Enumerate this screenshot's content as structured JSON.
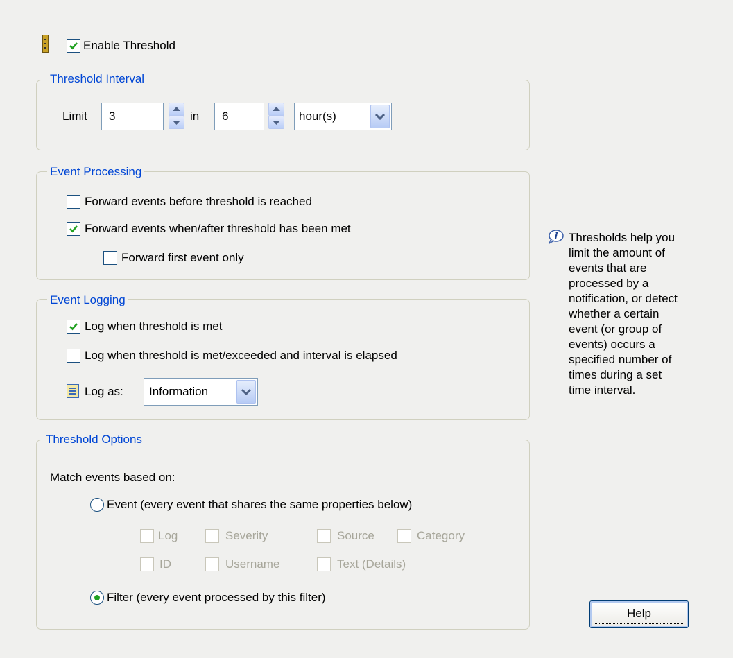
{
  "enable_threshold": {
    "label": "Enable Threshold",
    "checked": true,
    "icon": "ruler-icon"
  },
  "threshold_interval": {
    "legend": "Threshold Interval",
    "limit_label": "Limit",
    "limit_value": "3",
    "in_label": "in",
    "interval_value": "6",
    "unit_value": "hour(s)"
  },
  "event_processing": {
    "legend": "Event Processing",
    "forward_before": {
      "label": "Forward events before threshold is reached",
      "checked": false
    },
    "forward_after": {
      "label": "Forward events when/after threshold has been met",
      "checked": true
    },
    "forward_first": {
      "label": "Forward first event only",
      "checked": false
    }
  },
  "event_logging": {
    "legend": "Event Logging",
    "log_when_met": {
      "label": "Log when threshold is met",
      "checked": true
    },
    "log_when_exceeded": {
      "label": "Log when threshold is met/exceeded and interval is elapsed",
      "checked": false
    },
    "log_as_label": "Log as:",
    "log_as_value": "Information",
    "log_icon": "log-book-icon"
  },
  "threshold_options": {
    "legend": "Threshold Options",
    "match_label": "Match events based on:",
    "event_radio": {
      "label": "Event (every event that shares the same properties below)",
      "selected": false
    },
    "properties": {
      "log": "Log",
      "severity": "Severity",
      "source": "Source",
      "category": "Category",
      "id": "ID",
      "username": "Username",
      "text_details": "Text (Details)"
    },
    "filter_radio": {
      "label": "Filter (every event processed by this filter)",
      "selected": true
    }
  },
  "info": {
    "icon": "info-icon",
    "lines": [
      "Thresholds help you",
      "limit the amount of",
      "events that are",
      "processed by a",
      "notification, or detect",
      "whether a certain",
      "event (or group of",
      "events) occurs a",
      "specified number of",
      "times during a set",
      "time interval."
    ]
  },
  "help_button": {
    "label": "Help"
  },
  "colors": {
    "accent": "#0046d5",
    "check": "#21a121",
    "background": "#f0f0ee"
  }
}
